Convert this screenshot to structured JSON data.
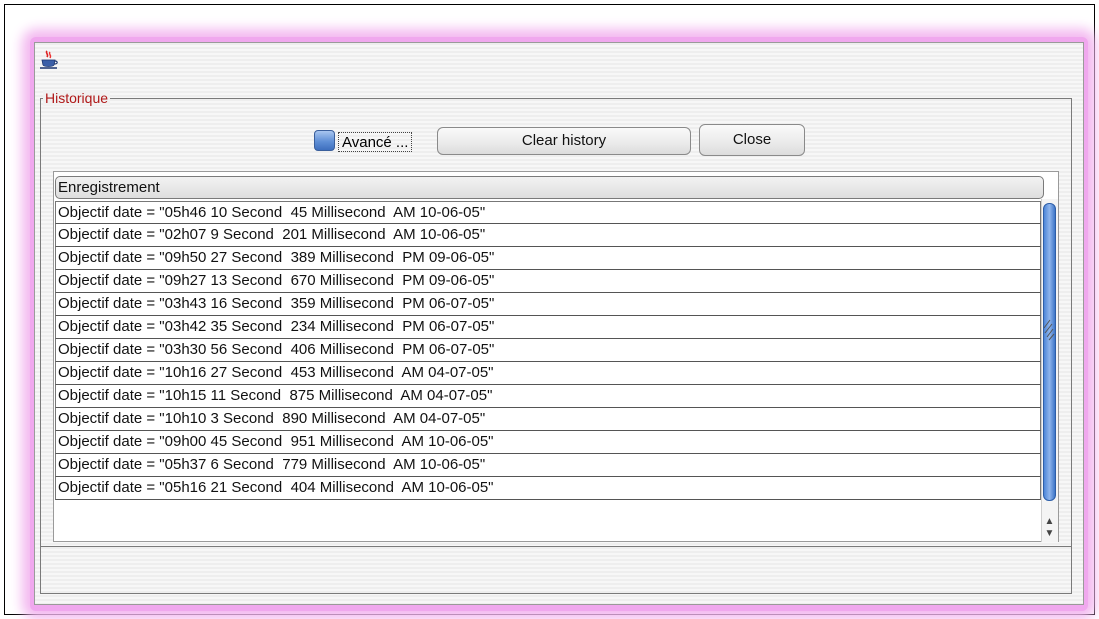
{
  "window": {
    "app_icon": "java-coffee-cup-icon"
  },
  "group": {
    "legend": "Historique"
  },
  "toolbar": {
    "advanced_checkbox_label": "Avancé ...",
    "advanced_checked": false,
    "clear_history_label": "Clear history",
    "close_label": "Close"
  },
  "table": {
    "column_header": "Enregistrement",
    "rows": [
      "Objectif date = \"05h46 10 Second  45 Millisecond  AM 10-06-05\"",
      "Objectif date = \"02h07 9 Second  201 Millisecond  AM 10-06-05\"",
      "Objectif date = \"09h50 27 Second  389 Millisecond  PM 09-06-05\"",
      "Objectif date = \"09h27 13 Second  670 Millisecond  PM 09-06-05\"",
      "Objectif date = \"03h43 16 Second  359 Millisecond  PM 06-07-05\"",
      "Objectif date = \"03h42 35 Second  234 Millisecond  PM 06-07-05\"",
      "Objectif date = \"03h30 56 Second  406 Millisecond  PM 06-07-05\"",
      "Objectif date = \"10h16 27 Second  453 Millisecond  AM 04-07-05\"",
      "Objectif date = \"10h15 11 Second  875 Millisecond  AM 04-07-05\"",
      "Objectif date = \"10h10 3 Second  890 Millisecond  AM 04-07-05\"",
      "Objectif date = \"09h00 45 Second  951 Millisecond  AM 10-06-05\"",
      "Objectif date = \"05h37 6 Second  779 Millisecond  AM 10-06-05\"",
      "Objectif date = \"05h16 21 Second  404 Millisecond  AM 10-06-05\""
    ]
  },
  "colors": {
    "legend_text": "#b01818",
    "window_glow": "#f0a8ee",
    "scroll_thumb": "#4d86d8"
  }
}
